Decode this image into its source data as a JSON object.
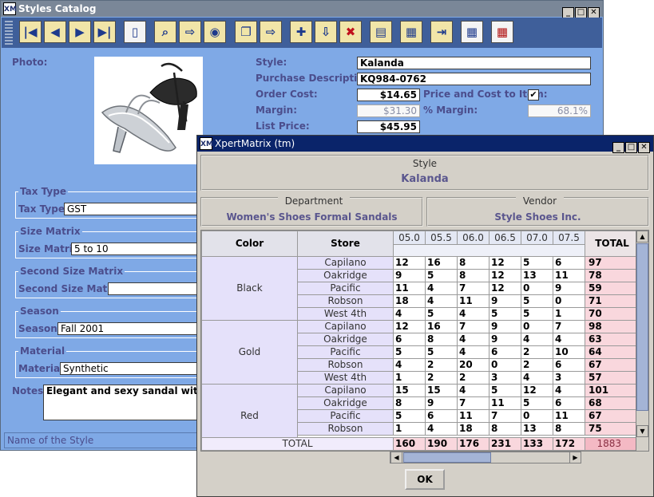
{
  "catalog": {
    "title": "Styles Catalog",
    "labels": {
      "photo": "Photo:",
      "style": "Style:",
      "purchase_description": "Purchase Description",
      "order_cost": "Order Cost:",
      "price_cost_to_item": "Price and Cost to Item:",
      "margin": "Margin:",
      "pct_margin": "% Margin:",
      "list_price": "List Price:",
      "notes": "Notes:"
    },
    "values": {
      "style": "Kalanda",
      "purchase_description": "KQ984-0762",
      "order_cost": "$14.65",
      "margin": "$31.30",
      "pct_margin": "68.1%",
      "list_price": "$45.95",
      "notes": "Elegant and sexy sandal with rhinestones"
    },
    "groups": [
      {
        "title": "Tax Type",
        "label": "Tax Type:",
        "value": "GST"
      },
      {
        "title": "Size Matrix",
        "label": "Size Matrix",
        "value": "5 to 10"
      },
      {
        "title": "Second Size Matrix",
        "label": "Second Size Matrix",
        "value": ""
      },
      {
        "title": "Season",
        "label": "Season:",
        "value": "Fall 2001"
      },
      {
        "title": "Material",
        "label": "Material:",
        "value": "Synthetic"
      }
    ],
    "status": "Name of the Style",
    "toolbar_icons": [
      "first-icon",
      "prev-icon",
      "next-icon",
      "last-icon",
      "new-doc-icon",
      "find-icon",
      "export-icon",
      "view-icon",
      "copy-icon",
      "paste-icon",
      "add-icon",
      "import-icon",
      "delete-icon",
      "print-icon",
      "matrix-icon",
      "exit-icon",
      "table-icon",
      "grid-icon"
    ]
  },
  "matrix": {
    "title": "XpertMatrix (tm)",
    "style_label": "Style",
    "style_value": "Kalanda",
    "department_label": "Department",
    "department_value": "Women's Shoes Formal Sandals",
    "vendor_label": "Vendor",
    "vendor_value": "Style Shoes Inc.",
    "headers": {
      "color": "Color",
      "store": "Store",
      "total": "TOTAL"
    },
    "sizes": [
      "05.0",
      "05.5",
      "06.0",
      "06.5",
      "07.0",
      "07.5"
    ],
    "groups": [
      {
        "color": "Black",
        "rows": [
          {
            "store": "Capilano",
            "values": [
              "12",
              "16",
              "8",
              "12",
              "5",
              "6"
            ],
            "total": "97"
          },
          {
            "store": "Oakridge",
            "values": [
              "9",
              "5",
              "8",
              "12",
              "13",
              "11"
            ],
            "total": "78"
          },
          {
            "store": "Pacific",
            "values": [
              "11",
              "4",
              "7",
              "12",
              "0",
              "9"
            ],
            "total": "59"
          },
          {
            "store": "Robson",
            "values": [
              "18",
              "4",
              "11",
              "9",
              "5",
              "0"
            ],
            "total": "71"
          },
          {
            "store": "West 4th",
            "values": [
              "4",
              "5",
              "4",
              "5",
              "5",
              "1"
            ],
            "total": "70"
          }
        ]
      },
      {
        "color": "Gold",
        "rows": [
          {
            "store": "Capilano",
            "values": [
              "12",
              "16",
              "7",
              "9",
              "0",
              "7"
            ],
            "total": "98"
          },
          {
            "store": "Oakridge",
            "values": [
              "6",
              "8",
              "4",
              "9",
              "4",
              "4"
            ],
            "total": "63"
          },
          {
            "store": "Pacific",
            "values": [
              "5",
              "5",
              "4",
              "6",
              "2",
              "10"
            ],
            "total": "64"
          },
          {
            "store": "Robson",
            "values": [
              "4",
              "2",
              "20",
              "0",
              "2",
              "6"
            ],
            "total": "67"
          },
          {
            "store": "West 4th",
            "values": [
              "1",
              "2",
              "2",
              "3",
              "4",
              "3"
            ],
            "total": "57"
          }
        ]
      },
      {
        "color": "Red",
        "rows": [
          {
            "store": "Capilano",
            "values": [
              "15",
              "15",
              "4",
              "5",
              "12",
              "4"
            ],
            "total": "101"
          },
          {
            "store": "Oakridge",
            "values": [
              "8",
              "9",
              "7",
              "11",
              "5",
              "6"
            ],
            "total": "68"
          },
          {
            "store": "Pacific",
            "values": [
              "5",
              "6",
              "11",
              "7",
              "0",
              "11"
            ],
            "total": "67"
          },
          {
            "store": "Robson",
            "values": [
              "1",
              "4",
              "18",
              "8",
              "13",
              "8"
            ],
            "total": "75"
          }
        ]
      }
    ],
    "total_label": "TOTAL",
    "totals": [
      "160",
      "190",
      "176",
      "231",
      "133",
      "172"
    ],
    "grand_total": "1883",
    "ok_label": "OK"
  }
}
